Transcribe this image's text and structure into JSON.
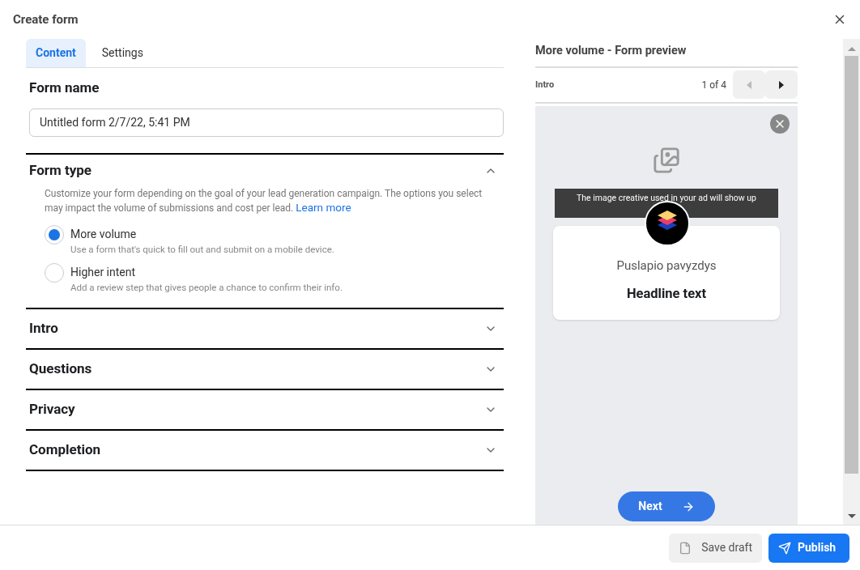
{
  "window": {
    "title": "Create form"
  },
  "tabs": [
    {
      "label": "Content",
      "selected": true
    },
    {
      "label": "Settings",
      "selected": false
    }
  ],
  "form_name": {
    "label": "Form name",
    "value": "Untitled form 2/7/22, 5:41 PM"
  },
  "sections": [
    {
      "title": "Form type",
      "expanded": true,
      "description": "Customize your form depending on the goal of your lead generation campaign. The options you select may impact the volume of submissions and cost per lead.",
      "link": "Learn more",
      "options": [
        {
          "label": "More volume",
          "hint": "Use a form that's quick to fill out and submit on a mobile device.",
          "selected": true
        },
        {
          "label": "Higher intent",
          "hint": "Add a review step that gives people a chance to confirm their info.",
          "selected": false
        }
      ]
    },
    {
      "title": "Intro",
      "expanded": false
    },
    {
      "title": "Questions",
      "expanded": false
    },
    {
      "title": "Privacy",
      "expanded": false
    },
    {
      "title": "Completion",
      "expanded": false
    }
  ],
  "preview": {
    "title": "More volume - Form preview",
    "step": "Intro",
    "page": "1 of 4",
    "prev_disabled": true,
    "next_disabled": false,
    "image_note": "The image creative used in your ad will show up",
    "page_name": "Puslapio pavyzdys",
    "headline": "Headline text",
    "next_button": "Next"
  },
  "footer": {
    "save_draft": "Save draft",
    "publish": "Publish"
  }
}
